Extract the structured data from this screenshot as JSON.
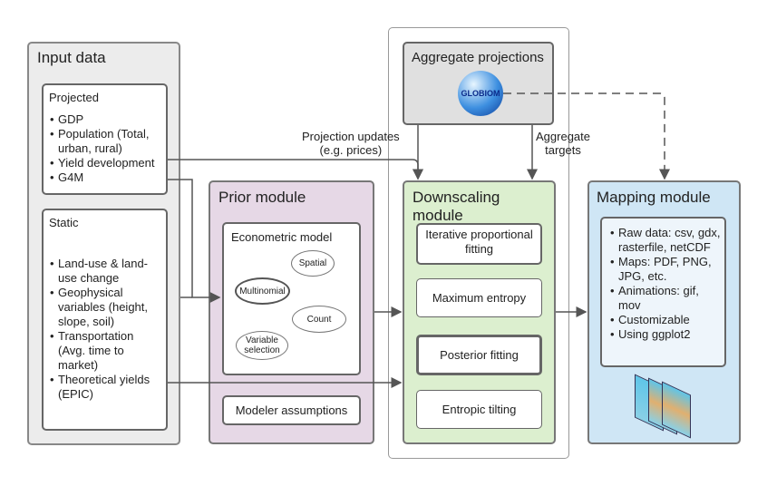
{
  "input": {
    "title": "Input data",
    "projected": {
      "title": "Projected",
      "items": [
        "GDP",
        "Population (Total, urban, rural)",
        "Yield development",
        "G4M"
      ]
    },
    "static": {
      "title": "Static",
      "items": [
        "Land-use & land-use change",
        "Geophysical variables (height, slope, soil)",
        "Transportation (Avg. time to market)",
        "Theoretical yields (EPIC)"
      ]
    }
  },
  "prior": {
    "title": "Prior module",
    "econ": {
      "title": "Econometric model",
      "methods": [
        "Spatial",
        "Multinomial",
        "Count",
        "Variable selection"
      ]
    },
    "assumptions": "Modeler assumptions"
  },
  "aggregate": {
    "title": "Aggregate projections",
    "logo": "GLOBIOM"
  },
  "labels": {
    "projection_updates": "Projection updates",
    "projection_eg": "(e.g. prices)",
    "aggregate_targets": "Aggregate",
    "aggregate_targets2": "targets"
  },
  "downscaling": {
    "title": "Downscaling",
    "title2": "module",
    "steps": [
      "Iterative proportional fitting",
      "Maximum entropy",
      "Posterior fitting",
      "Entropic tilting"
    ]
  },
  "mapping": {
    "title": "Mapping module",
    "items": [
      "Raw data: csv, gdx, rasterfile, netCDF",
      "Maps: PDF, PNG, JPG, etc.",
      "Animations: gif, mov",
      "Customizable",
      "Using ggplot2"
    ]
  },
  "colors": {
    "input": "#ececec",
    "prior": "#e6d8e6",
    "downscaling": "#dcefcf",
    "mapping": "#cfe6f5",
    "aggregate": "#e0e0e0"
  }
}
